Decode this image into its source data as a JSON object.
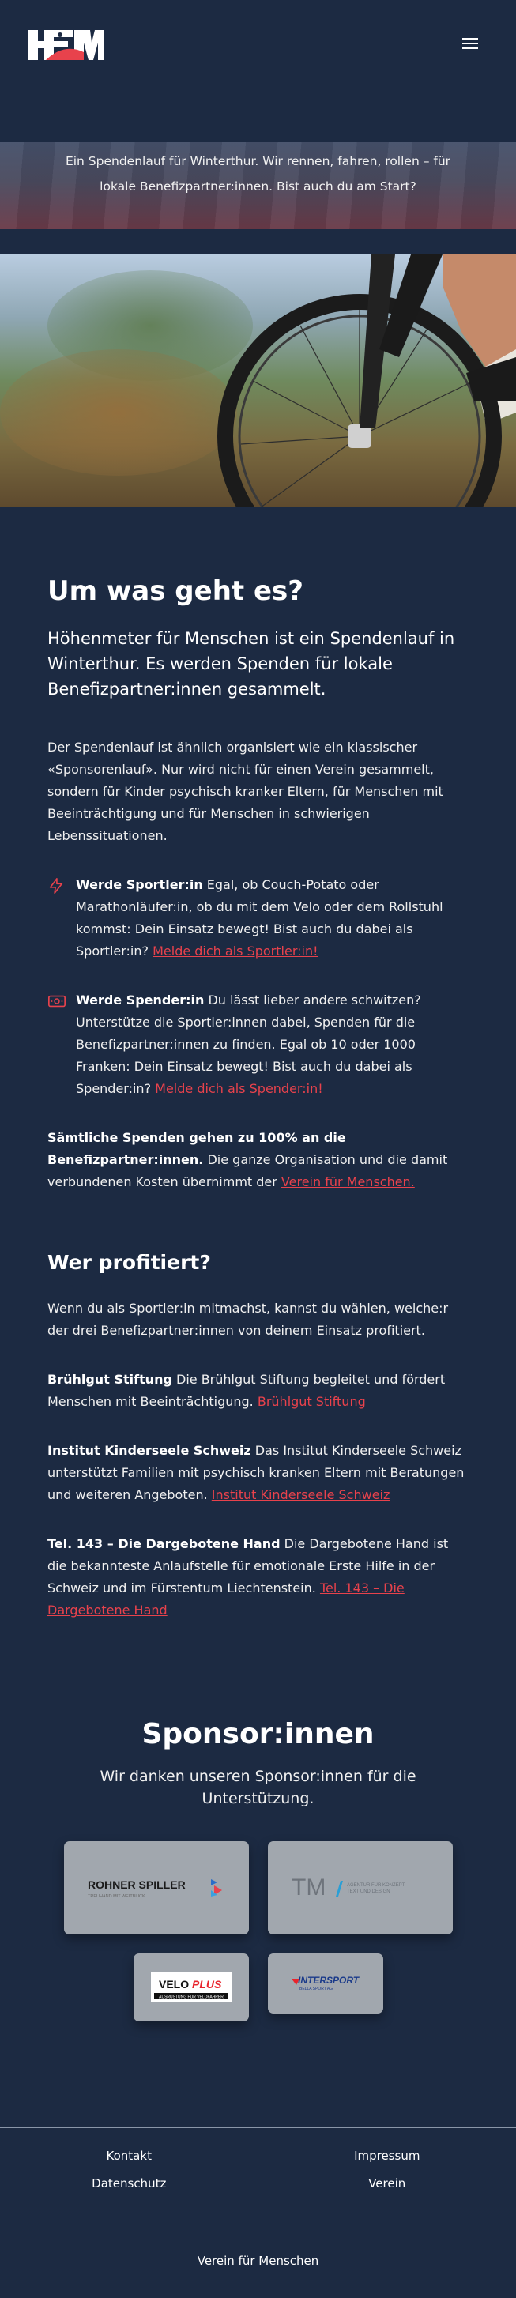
{
  "header": {
    "logo_text": "HFM",
    "menu_icon": "hamburger-icon"
  },
  "hero": {
    "text": "Ein Spendenlauf für Winterthur. Wir rennen, fahren, rollen – für lokale Benefizpartner:innen. Bist auch du am Start?"
  },
  "about": {
    "title": "Um was geht es?",
    "lead": "Höhenmeter für Menschen ist ein Spendenlauf in Winterthur. Es werden Spenden für lokale Benefizpartner:innen gesammelt.",
    "intro": "Der Spendenlauf ist ähnlich organisiert wie ein klassischer «Sponsorenlauf». Nur wird nicht für einen Verein gesammelt, sondern für Kinder psychisch kranker Eltern, für Menschen mit Beeinträchtigung und für Menschen in schwierigen Lebenssituationen.",
    "features": [
      {
        "icon": "lightning-icon",
        "title": "Werde Sportler:in",
        "text": " Egal, ob Couch-Potato oder Marathonläufer:in, ob du mit dem Velo oder dem Rollstuhl kommst: Dein Einsatz bewegt! Bist auch du dabei als Sportler:in? ",
        "link": "Melde dich als Sportler:in!"
      },
      {
        "icon": "money-icon",
        "title": "Werde Spender:in",
        "text": " Du lässt lieber andere schwitzen? Unterstütze die Sportler:innen dabei, Spenden für die Benefizpartner:innen zu finden. Egal ob 10 oder 1000 Franken: Dein Einsatz bewegt! Bist auch du dabei als Spender:in? ",
        "link": "Melde dich als Spender:in!"
      }
    ],
    "note_bold": "Sämtliche Spenden gehen zu 100% an die Benefizpartner:innen.",
    "note_text": " Die ganze Organisation und die damit verbundenen Kosten übernimmt der ",
    "note_link": "Verein für Menschen."
  },
  "beneficiaries": {
    "title": "Wer profitiert?",
    "intro": "Wenn du als Sportler:in mitmachst, kannst du wählen, welche:r der drei Benefizpartner:innen von deinem Einsatz profitiert.",
    "items": [
      {
        "name": "Brühlgut Stiftung",
        "text": " Die Brühlgut Stiftung begleitet und fördert Menschen mit Beeinträchtigung. ",
        "link": "Brühlgut Stiftung"
      },
      {
        "name": "Institut Kinderseele Schweiz",
        "text": " Das Institut Kinderseele Schweiz unterstützt Familien mit psychisch kranken Eltern mit Beratungen und weiteren Angeboten. ",
        "link": "Institut Kinderseele Schweiz"
      },
      {
        "name": "Tel. 143 – Die Dargebotene Hand",
        "text": " Die Dargebotene Hand ist die bekannteste Anlaufstelle für emotionale Erste Hilfe in der Schweiz und im Fürstentum Liechtenstein. ",
        "link": "Tel. 143 – Die Dargebotene Hand"
      }
    ]
  },
  "sponsors": {
    "title": "Sponsor:innen",
    "subtitle": "Wir danken unseren Sponsor:innen für die Unterstützung.",
    "logos": [
      {
        "name": "ROHNER SPILLER",
        "tagline": "TREUHAND MIT WEITBLICK"
      },
      {
        "name": "TM",
        "tagline": "AGENTUR FÜR KONZEPT, TEXT UND DESIGN"
      },
      {
        "name": "VELOPLUS",
        "tagline": "AUSRÜSTUNG FÜR VELOFAHRER"
      },
      {
        "name": "INTERSPORT",
        "tagline": "BELLA SPORT AG"
      }
    ]
  },
  "footer": {
    "links": [
      "Kontakt",
      "Impressum",
      "Datenschutz",
      "Verein"
    ],
    "org": "Verein für Menschen"
  },
  "colors": {
    "background": "#1c2a42",
    "accent": "#e8424c",
    "card": "#a1a7ae"
  }
}
